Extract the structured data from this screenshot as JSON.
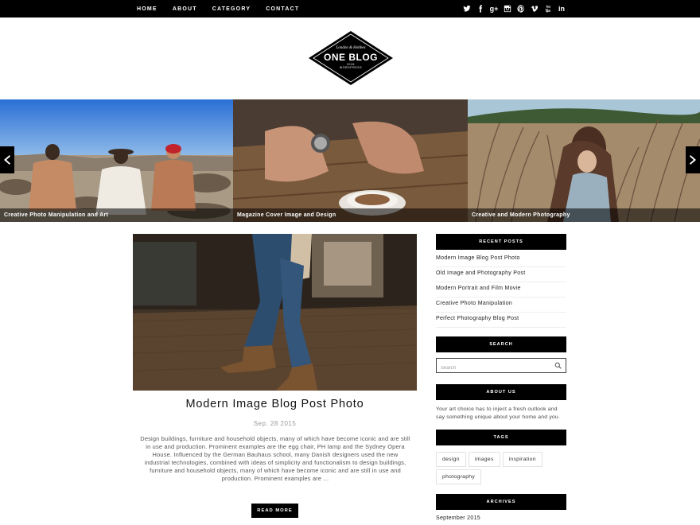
{
  "nav": {
    "items": [
      "HOME",
      "ABOUT",
      "CATEGORY",
      "CONTACT"
    ]
  },
  "social": {
    "icons": [
      "twitter-icon",
      "facebook-icon",
      "google-plus-icon",
      "instagram-icon",
      "pinterest-icon",
      "vimeo-icon",
      "youtube-icon",
      "linkedin-icon"
    ],
    "google_plus_glyph": "g+",
    "linkedin_glyph": "in"
  },
  "logo": {
    "top_line": "London & Hobbes",
    "title": "ONE BLOG",
    "year": "2015",
    "sub": "WORDPRESS"
  },
  "slider": {
    "slides": [
      {
        "caption": "Creative Photo Manipulation and Art"
      },
      {
        "caption": "Magazine Cover Image and Design"
      },
      {
        "caption": "Creative and Modern Photography"
      }
    ]
  },
  "post": {
    "title": "Modern Image Blog Post Photo",
    "date": "Sep. 28 2015",
    "excerpt": "Design buildings, furniture and household objects, many of which have become iconic and are still in use and production. Prominent examples are the egg chair, PH lamp and the Sydney Opera House. Influenced by the German Bauhaus school, many Danish designers used the new industrial technologies, combined with ideas of simplicity and functionalism to design buildings, furniture and household objects, many of which have become iconic and are still in use and production. Prominent examples are ...",
    "read_more": "READ MORE"
  },
  "sidebar": {
    "recent_heading": "RECENT POSTS",
    "recent_posts": [
      "Modern Image Blog Post Photo",
      "Old Image and Photography Post",
      "Modern Portrait and Film Movie",
      "Creative Photo Manipulation",
      "Perfect Photography Blog Post"
    ],
    "search_heading": "SEARCH",
    "search_placeholder": "Search",
    "about_heading": "ABOUT US",
    "about_text": "Your art choice has to inject a fresh outlook and say something unique about your home and you.",
    "tags_heading": "TAGS",
    "tags": [
      "design",
      "images",
      "inspiration",
      "photography"
    ],
    "archives_heading": "ARCHIVES",
    "archives": [
      "September 2015"
    ]
  }
}
